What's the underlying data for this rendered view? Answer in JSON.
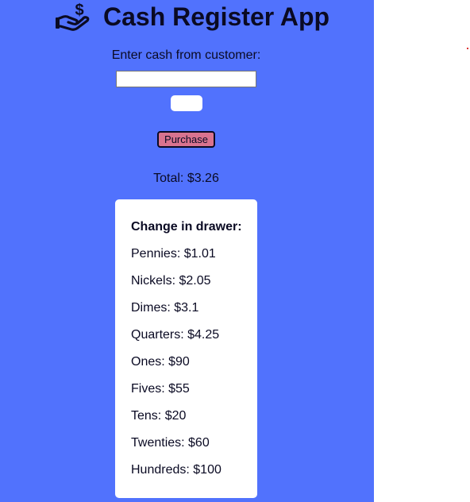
{
  "header": {
    "title": "Cash Register App",
    "logo_icon": "hand-dollar-icon"
  },
  "form": {
    "cash_label": "Enter cash from customer:",
    "cash_value": "",
    "purchase_label": "Purchase"
  },
  "total": "Total: $3.26",
  "drawer": {
    "title": "Change in drawer:",
    "items": [
      "Pennies: $1.01",
      "Nickels: $2.05",
      "Dimes: $3.1",
      "Quarters: $4.25",
      "Ones: $90",
      "Fives: $55",
      "Tens: $20",
      "Twenties: $60",
      "Hundreds: $100"
    ]
  },
  "colors": {
    "panel_background": "#5172fd",
    "purchase_button": "#d9738f",
    "text": "#0a0a23"
  }
}
